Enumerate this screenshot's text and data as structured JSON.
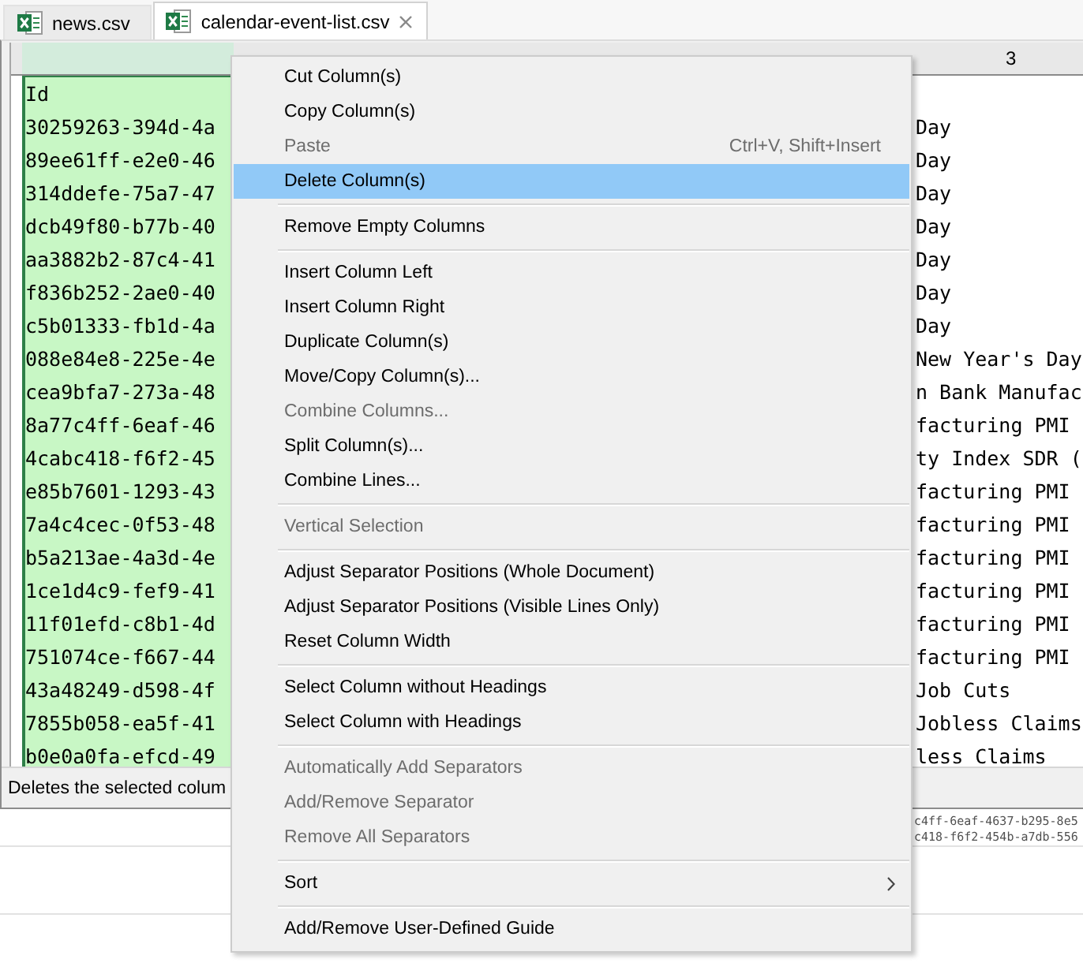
{
  "tabs": [
    {
      "label": "news.csv",
      "selected": false
    },
    {
      "label": "calendar-event-list.csv",
      "selected": true
    }
  ],
  "table": {
    "columns": {
      "column_1": {
        "selected": true
      },
      "column_3": {
        "label": "3",
        "selected": false
      }
    },
    "rows": [
      {
        "column_1": "Id"
      },
      {
        "column_1": "30259263-394d-4a",
        "column_3": "Day"
      },
      {
        "column_1": "89ee61ff-e2e0-46",
        "column_3": "Day"
      },
      {
        "column_1": "314ddefe-75a7-47",
        "column_3": "Day"
      },
      {
        "column_1": "dcb49f80-b77b-40",
        "column_3": "Day"
      },
      {
        "column_1": "aa3882b2-87c4-41",
        "column_3": "Day"
      },
      {
        "column_1": "f836b252-2ae0-40",
        "column_3": "Day"
      },
      {
        "column_1": "c5b01333-fb1d-4a",
        "column_3": "Day"
      },
      {
        "column_1": "088e84e8-225e-4e",
        "column_3": "New Year's Day"
      },
      {
        "column_1": "cea9bfa7-273a-48",
        "column_3": "n Bank Manufac"
      },
      {
        "column_1": "8a77c4ff-6eaf-46",
        "column_3": "facturing PMI"
      },
      {
        "column_1": "4cabc418-f6f2-45",
        "column_3": "ty Index SDR ("
      },
      {
        "column_1": "e85b7601-1293-43",
        "column_3": "facturing PMI"
      },
      {
        "column_1": "7a4c4cec-0f53-48",
        "column_3": "facturing PMI"
      },
      {
        "column_1": "b5a213ae-4a3d-4e",
        "column_3": "facturing PMI"
      },
      {
        "column_1": "1ce1d4c9-fef9-41",
        "column_3": "facturing PMI"
      },
      {
        "column_1": "11f01efd-c8b1-4d",
        "column_3": "facturing PMI"
      },
      {
        "column_1": "751074ce-f667-44",
        "column_3": "facturing PMI"
      },
      {
        "column_1": "43a48249-d598-4f",
        "column_3": "Job Cuts"
      },
      {
        "column_1": "7855b058-ea5f-41",
        "column_3": "Jobless Claims"
      },
      {
        "column_1": "b0e0a0fa-efcd-49",
        "column_3": "less Claims"
      }
    ]
  },
  "status_bar": {
    "text": "Deletes the selected colum"
  },
  "background_pane": {
    "lines": [
      "c4ff-6eaf-4637-b295-8e5",
      "c418-f6f2-454b-a7db-556"
    ]
  },
  "context_menu": {
    "groups": [
      {
        "items": [
          {
            "kind": "command",
            "label": "Cut Column(s)",
            "disabled": false,
            "selected": false
          },
          {
            "kind": "command",
            "label": "Copy Column(s)",
            "disabled": false,
            "selected": false
          },
          {
            "kind": "command",
            "label": "Paste",
            "shortcut": "Ctrl+V, Shift+Insert",
            "disabled": true,
            "selected": false
          },
          {
            "kind": "command",
            "label": "Delete Column(s)",
            "disabled": false,
            "selected": true
          }
        ]
      },
      {
        "items": [
          {
            "kind": "command",
            "label": "Remove Empty Columns",
            "disabled": false,
            "selected": false
          }
        ]
      },
      {
        "items": [
          {
            "kind": "command",
            "label": "Insert Column Left",
            "disabled": false,
            "selected": false
          },
          {
            "kind": "command",
            "label": "Insert Column Right",
            "disabled": false,
            "selected": false
          },
          {
            "kind": "command",
            "label": "Duplicate Column(s)",
            "disabled": false,
            "selected": false
          },
          {
            "kind": "command",
            "label": "Move/Copy Column(s)...",
            "disabled": false,
            "selected": false
          },
          {
            "kind": "command",
            "label": "Combine Columns...",
            "disabled": true,
            "selected": false
          },
          {
            "kind": "command",
            "label": "Split Column(s)...",
            "disabled": false,
            "selected": false
          },
          {
            "kind": "command",
            "label": "Combine Lines...",
            "disabled": false,
            "selected": false
          }
        ]
      },
      {
        "items": [
          {
            "kind": "command",
            "label": "Vertical Selection",
            "disabled": true,
            "selected": false
          }
        ]
      },
      {
        "items": [
          {
            "kind": "command",
            "label": "Adjust Separator Positions (Whole Document)",
            "disabled": false,
            "selected": false
          },
          {
            "kind": "command",
            "label": "Adjust Separator Positions (Visible Lines Only)",
            "disabled": false,
            "selected": false
          },
          {
            "kind": "command",
            "label": "Reset Column Width",
            "disabled": false,
            "selected": false
          }
        ]
      },
      {
        "items": [
          {
            "kind": "command",
            "label": "Select Column without Headings",
            "disabled": false,
            "selected": false
          },
          {
            "kind": "command",
            "label": "Select Column with Headings",
            "disabled": false,
            "selected": false
          }
        ]
      },
      {
        "items": [
          {
            "kind": "command",
            "label": "Automatically Add Separators",
            "disabled": true,
            "selected": false
          },
          {
            "kind": "command",
            "label": "Add/Remove Separator",
            "disabled": true,
            "selected": false
          },
          {
            "kind": "command",
            "label": "Remove All Separators",
            "disabled": true,
            "selected": false
          }
        ]
      },
      {
        "items": [
          {
            "kind": "submenu",
            "label": "Sort",
            "disabled": false,
            "selected": false
          }
        ]
      },
      {
        "items": [
          {
            "kind": "command",
            "label": "Add/Remove User-Defined Guide",
            "disabled": false,
            "selected": false
          }
        ]
      }
    ]
  }
}
